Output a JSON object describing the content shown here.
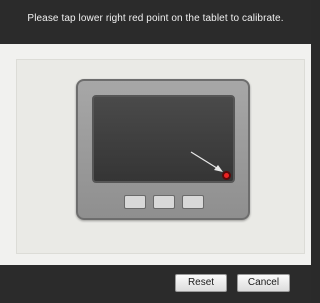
{
  "dialog": {
    "instruction": "Please tap lower right red point on the tablet to calibrate."
  },
  "buttons": {
    "reset_label": "Reset",
    "cancel_label": "Cancel"
  },
  "colors": {
    "bar_background": "#2b2b2b",
    "content_background": "#f1f1ef",
    "target_point": "#ee2222"
  },
  "icons": {
    "tablet": "tablet-illustration",
    "target": "red-calibration-point",
    "arrow": "pointer-arrow"
  }
}
